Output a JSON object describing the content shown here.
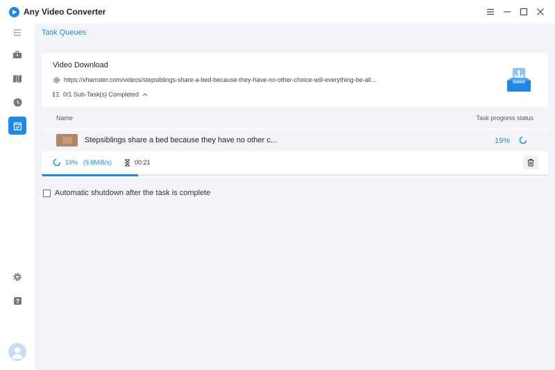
{
  "app": {
    "title": "Any Video Converter",
    "accent_color": "#1e88e5"
  },
  "window_controls": [
    {
      "name": "menu",
      "icon": "hamburger-icon"
    },
    {
      "name": "minimize",
      "icon": "minimize-icon"
    },
    {
      "name": "maximize",
      "icon": "maximize-icon"
    },
    {
      "name": "close",
      "icon": "close-icon"
    }
  ],
  "sidebar": {
    "items": [
      {
        "icon": "collapse-menu-icon",
        "active": false
      },
      {
        "icon": "toolbox-icon",
        "active": false
      },
      {
        "icon": "map-icon",
        "active": false
      },
      {
        "icon": "history-clock-icon",
        "active": false
      },
      {
        "icon": "task-queue-icon",
        "active": true
      }
    ],
    "bottom_items": [
      {
        "icon": "settings-icon"
      },
      {
        "icon": "help-icon"
      }
    ],
    "avatar_icon": "user-avatar-icon"
  },
  "main": {
    "page_title": "Task Queues",
    "task_card": {
      "title": "Video Download",
      "url": "https://xhamster.com/videos/stepsiblings-share-a-bed-because-they-have-no-other-choice-will-everything-be-all...",
      "subtasks_label": "0/1 Sub-Task(s) Completed",
      "table": {
        "col_name": "Name",
        "col_status": "Task progress status"
      },
      "task": {
        "name": "Stepsiblings share a bed because they have no other c...",
        "percent_label": "19%",
        "progress": 0.19,
        "speed": "(9.8MiB/s)",
        "elapsed": "00:21"
      }
    },
    "shutdown_option": {
      "label": "Automatic shutdown after the task is complete",
      "checked": false
    }
  }
}
